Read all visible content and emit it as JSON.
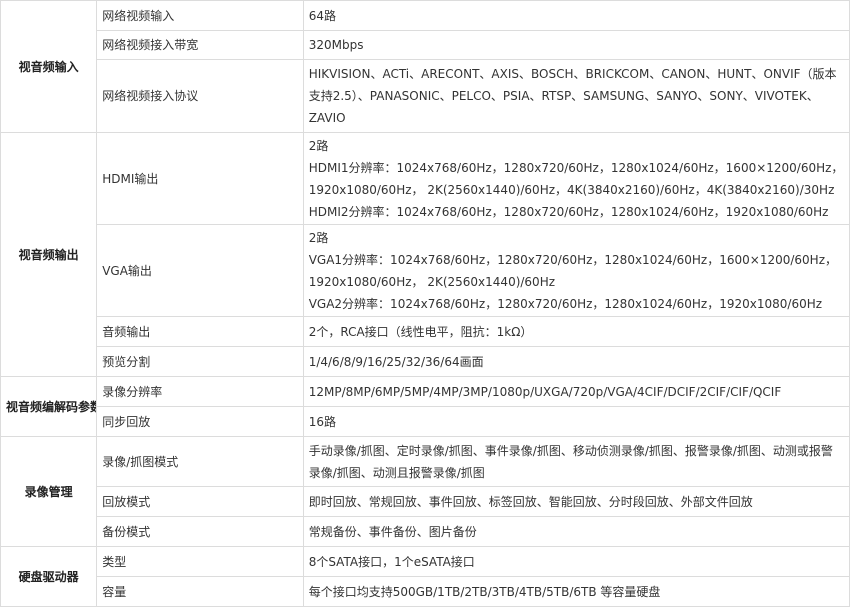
{
  "groups": [
    {
      "category": "视音频输入",
      "rows": [
        {
          "name": "网络视频输入",
          "lines": [
            "64路"
          ]
        },
        {
          "name": "网络视频接入带宽",
          "lines": [
            "320Mbps"
          ]
        },
        {
          "name": "网络视频接入协议",
          "lines": [
            "HIKVISION、ACTi、ARECONT、AXIS、BOSCH、BRICKCOM、CANON、HUNT、ONVIF（版本",
            "支持2.5）、PANASONIC、PELCO、PSIA、RTSP、SAMSUNG、SANYO、SONY、VIVOTEK、",
            "ZAVIO"
          ]
        }
      ]
    },
    {
      "category": "视音频输出",
      "rows": [
        {
          "name": "HDMI输出",
          "lines": [
            "2路",
            "HDMI1分辨率：1024x768/60Hz，1280x720/60Hz，1280x1024/60Hz，1600×1200/60Hz，",
            "1920x1080/60Hz， 2K(2560x1440)/60Hz，4K(3840x2160)/60Hz，4K(3840x2160)/30Hz",
            "HDMI2分辨率：1024x768/60Hz，1280x720/60Hz，1280x1024/60Hz，1920x1080/60Hz"
          ]
        },
        {
          "name": "VGA输出",
          "lines": [
            "2路",
            "VGA1分辨率：1024x768/60Hz，1280x720/60Hz，1280x1024/60Hz，1600×1200/60Hz，",
            "1920x1080/60Hz， 2K(2560x1440)/60Hz",
            "VGA2分辨率：1024x768/60Hz，1280x720/60Hz，1280x1024/60Hz，1920x1080/60Hz"
          ]
        },
        {
          "name": "音频输出",
          "lines": [
            "2个，RCA接口（线性电平，阻抗：1kΩ）"
          ]
        },
        {
          "name": "预览分割",
          "lines": [
            "1/4/6/8/9/16/25/32/36/64画面"
          ]
        }
      ]
    },
    {
      "category": "视音频编解码参数",
      "rows": [
        {
          "name": "录像分辨率",
          "lines": [
            "12MP/8MP/6MP/5MP/4MP/3MP/1080p/UXGA/720p/VGA/4CIF/DCIF/2CIF/CIF/QCIF"
          ]
        },
        {
          "name": "同步回放",
          "lines": [
            "16路"
          ]
        }
      ]
    },
    {
      "category": "录像管理",
      "rows": [
        {
          "name": "录像/抓图模式",
          "lines": [
            "手动录像/抓图、定时录像/抓图、事件录像/抓图、移动侦测录像/抓图、报警录像/抓图、动测或报警",
            "录像/抓图、动测且报警录像/抓图"
          ]
        },
        {
          "name": "回放模式",
          "lines": [
            "即时回放、常规回放、事件回放、标签回放、智能回放、分时段回放、外部文件回放"
          ]
        },
        {
          "name": "备份模式",
          "lines": [
            "常规备份、事件备份、图片备份"
          ]
        }
      ]
    },
    {
      "category": "硬盘驱动器",
      "rows": [
        {
          "name": "类型",
          "lines": [
            "8个SATA接口，1个eSATA接口"
          ]
        },
        {
          "name": "容量",
          "lines": [
            "每个接口均支持500GB/1TB/2TB/3TB/4TB/5TB/6TB 等容量硬盘"
          ]
        }
      ]
    }
  ]
}
